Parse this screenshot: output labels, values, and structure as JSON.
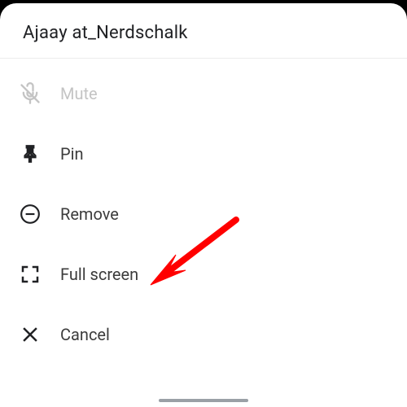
{
  "header": {
    "title": "Ajaay at_Nerdschalk"
  },
  "menu": {
    "items": [
      {
        "label": "Mute",
        "icon": "mic-off-icon",
        "enabled": false
      },
      {
        "label": "Pin",
        "icon": "pin-icon",
        "enabled": true
      },
      {
        "label": "Remove",
        "icon": "remove-icon",
        "enabled": true
      },
      {
        "label": "Full screen",
        "icon": "fullscreen-icon",
        "enabled": true
      },
      {
        "label": "Cancel",
        "icon": "close-icon",
        "enabled": true
      }
    ]
  },
  "annotation": {
    "arrow_color": "#ff0000",
    "target": "fullscreen"
  }
}
